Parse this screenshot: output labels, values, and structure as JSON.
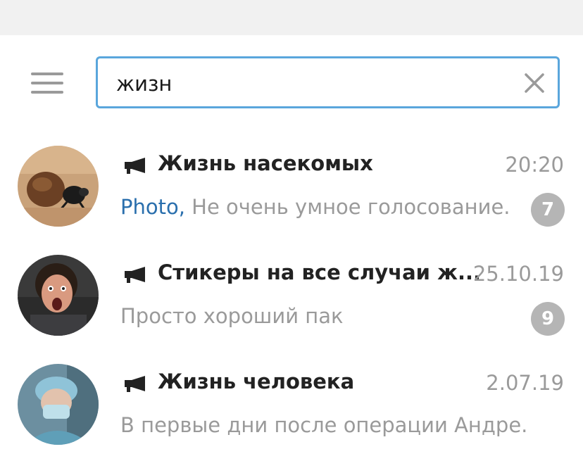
{
  "search": {
    "query": "жизн",
    "placeholder": ""
  },
  "chats": [
    {
      "title": "Жизнь насекомых",
      "time": "20:20",
      "media_label": "Photo,",
      "preview": " Не очень умное голосование.",
      "unread": "7",
      "avatar_icon": "beetle-photo"
    },
    {
      "title": "Стикеры на все случаи ж...",
      "time": "25.10.19",
      "media_label": "",
      "preview": "Просто хороший пак",
      "unread": "9",
      "avatar_icon": "screaming-woman-photo"
    },
    {
      "title": "Жизнь человека",
      "time": "2.07.19",
      "media_label": "",
      "preview": "В первые дни после операции Андре...",
      "unread": "",
      "avatar_icon": "surgeon-photo"
    }
  ],
  "colors": {
    "accent": "#5aa6dc",
    "link": "#2a6fad",
    "muted": "#9a9a9a",
    "badge": "#b5b5b5"
  }
}
